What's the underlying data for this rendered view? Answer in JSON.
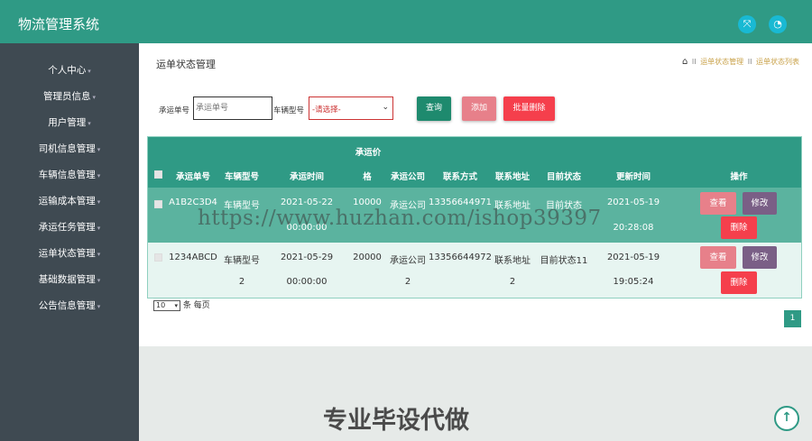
{
  "app": {
    "title": "物流管理系统"
  },
  "header_icons": [
    {
      "icon": "fullscreen-icon",
      "glyph": "⤧"
    },
    {
      "icon": "user-icon",
      "glyph": "◔"
    }
  ],
  "sidebar": {
    "items": [
      {
        "label": "个人中心"
      },
      {
        "label": "管理员信息"
      },
      {
        "label": "用户管理"
      },
      {
        "label": "司机信息管理"
      },
      {
        "label": "车辆信息管理"
      },
      {
        "label": "运输成本管理"
      },
      {
        "label": "承运任务管理"
      },
      {
        "label": "运单状态管理"
      },
      {
        "label": "基础数据管理"
      },
      {
        "label": "公告信息管理"
      }
    ]
  },
  "page": {
    "title": "运单状态管理",
    "breadcrumb": {
      "home_icon": "home-icon",
      "sep": "II",
      "item1": "运单状态管理",
      "item2": "运单状态列表"
    }
  },
  "search": {
    "label1": "承运单号",
    "input1_placeholder": "承运单号",
    "label2": "车辆型号",
    "select_value": "-请选择-",
    "query_btn": "查询",
    "add_btn": "添加",
    "batch_delete_btn": "批量删除"
  },
  "table": {
    "header_top": "承运价",
    "columns": [
      "承运单号",
      "车辆型号",
      "承运时间",
      "格",
      "承运公司",
      "联系方式",
      "联系地址",
      "目前状态",
      "更新时间",
      "操作"
    ],
    "rows": [
      {
        "line1": [
          "A1B2C3D4",
          "车辆型号",
          "2021-05-22",
          "10000",
          "承运公司",
          "13356644971",
          "联系地址",
          "目前状态",
          "2021-05-19"
        ],
        "line2": [
          "00:00:00",
          "20:28:08"
        ]
      },
      {
        "line1": [
          "1234ABCD",
          "车辆型号",
          "2021-05-29",
          "20000",
          "承运公司",
          "13356644972",
          "联系地址",
          "目前状态11",
          "2021-05-19"
        ],
        "line2": [
          "2",
          "00:00:00",
          "2",
          "2",
          "19:05:24"
        ]
      }
    ],
    "actions": {
      "view": "查看",
      "edit": "修改",
      "delete": "删除"
    }
  },
  "pager": {
    "page_size": "10",
    "per_page_label": "条 每页",
    "current_page": "1"
  },
  "overlay": {
    "watermark": "https://www.huzhan.com/ishop39397",
    "promo": "专业毕设代做"
  },
  "colors": {
    "primary": "#2f9a85",
    "sidebar": "#3f4a52",
    "danger": "#f53f4c",
    "view": "#e7808a",
    "edit": "#7a5f86"
  }
}
